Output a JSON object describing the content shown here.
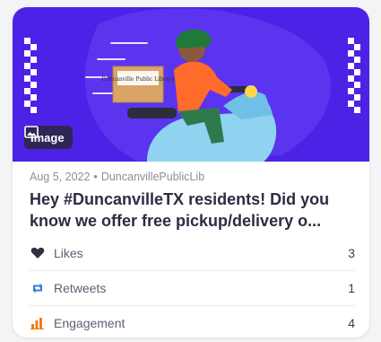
{
  "post": {
    "media_badge": "Image",
    "date": "Aug 5, 2022",
    "separator": "•",
    "author": "DuncanvillePublicLib",
    "title": "Hey #DuncanvilleTX residents! Did you know we offer free pickup/delivery o...",
    "box_label": "Duncanville Public Library"
  },
  "stats": [
    {
      "label": "Likes",
      "value": "3",
      "icon": "heart-icon"
    },
    {
      "label": "Retweets",
      "value": "1",
      "icon": "retweet-icon"
    },
    {
      "label": "Engagement",
      "value": "4",
      "icon": "bar-chart-icon"
    }
  ],
  "colors": {
    "hero_bg": "#4b22e6",
    "likes_icon": "#2f3142",
    "retweets_icon": "#3a7bd5",
    "engagement_icon": "#f07a1a"
  }
}
